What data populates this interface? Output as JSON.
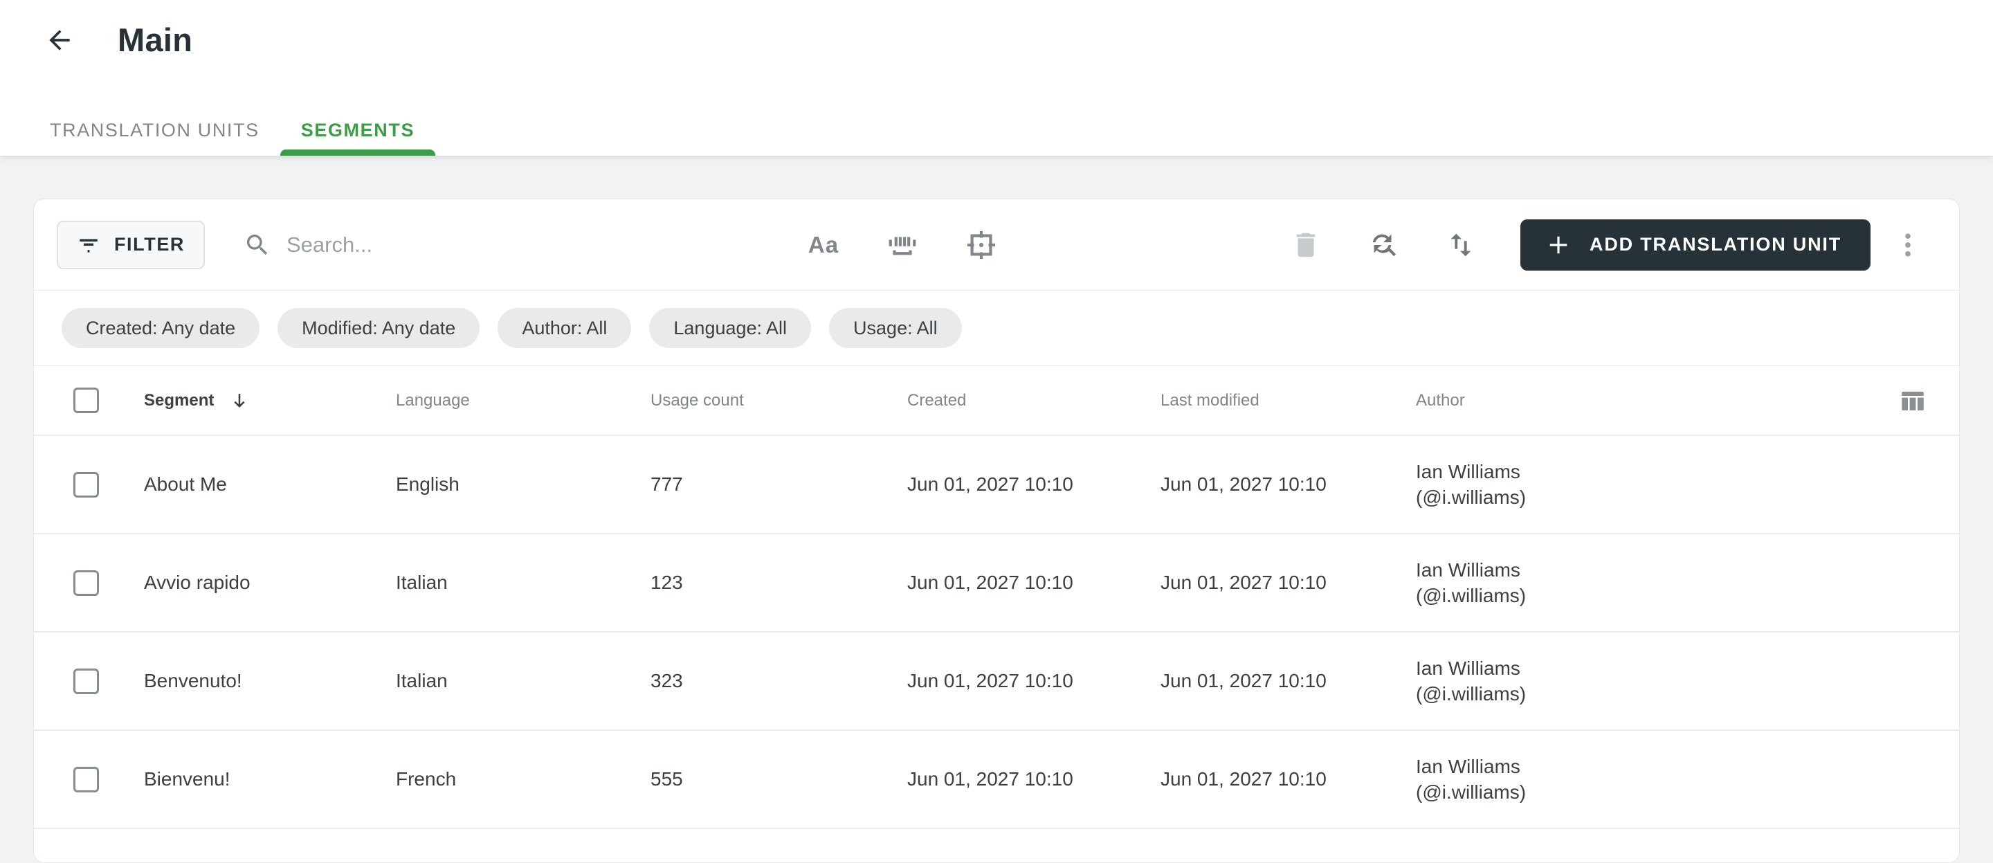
{
  "header": {
    "title": "Main"
  },
  "tabs": [
    {
      "label": "TRANSLATION UNITS",
      "active": false
    },
    {
      "label": "SEGMENTS",
      "active": true
    }
  ],
  "toolbar": {
    "filter_label": "FILTER",
    "search_placeholder": "Search...",
    "match_case_label": "Aa",
    "add_button_label": "ADD TRANSLATION UNIT"
  },
  "filter_chips": [
    "Created: Any date",
    "Modified: Any date",
    "Author: All",
    "Language: All",
    "Usage: All"
  ],
  "table": {
    "columns": {
      "segment": "Segment",
      "language": "Language",
      "usage_count": "Usage count",
      "created": "Created",
      "last_modified": "Last modified",
      "author": "Author"
    },
    "sort": {
      "column": "Segment",
      "direction": "descending"
    },
    "rows": [
      {
        "segment": "About Me",
        "language": "English",
        "usage_count": "777",
        "created": "Jun 01, 2027 10:10",
        "last_modified": "Jun 01, 2027 10:10",
        "author_name": "Ian Williams",
        "author_handle": "(@i.williams)"
      },
      {
        "segment": "Avvio rapido",
        "language": "Italian",
        "usage_count": "123",
        "created": "Jun 01, 2027 10:10",
        "last_modified": "Jun 01, 2027 10:10",
        "author_name": "Ian Williams",
        "author_handle": "(@i.williams)"
      },
      {
        "segment": "Benvenuto!",
        "language": "Italian",
        "usage_count": "323",
        "created": "Jun 01, 2027 10:10",
        "last_modified": "Jun 01, 2027 10:10",
        "author_name": "Ian Williams",
        "author_handle": "(@i.williams)"
      },
      {
        "segment": "Bienvenu!",
        "language": "French",
        "usage_count": "555",
        "created": "Jun 01, 2027 10:10",
        "last_modified": "Jun 01, 2027 10:10",
        "author_name": "Ian Williams",
        "author_handle": "(@i.williams)"
      }
    ]
  },
  "colors": {
    "accent_green": "#3d9c47",
    "dark_button": "#263238",
    "page_background": "#f1f2f4",
    "chip_background": "#e9eaeb",
    "muted_text": "#80868b",
    "body_text": "#3c4043"
  }
}
